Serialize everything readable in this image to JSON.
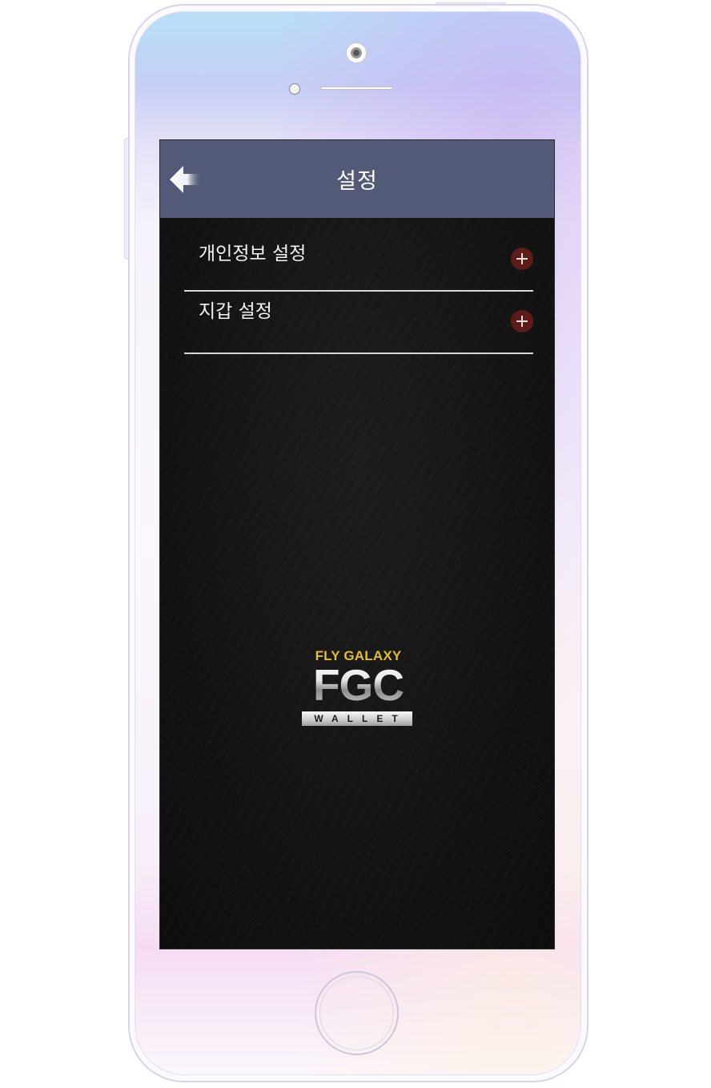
{
  "header": {
    "title": "설정",
    "back_icon": "arrow-left-icon"
  },
  "menu": {
    "items": [
      {
        "label": "개인정보 설정",
        "icon": "plus-icon"
      },
      {
        "label": "지갑 설정",
        "icon": "plus-icon"
      }
    ]
  },
  "logo": {
    "top_text": "FLY GALAXY",
    "main_text": "FGC",
    "bottom_text": "WALLET"
  },
  "colors": {
    "header_bg": "#525a78",
    "plus_button_bg": "#5e1c18",
    "logo_gold": "#e3be2c",
    "screen_bg": "#131313"
  }
}
